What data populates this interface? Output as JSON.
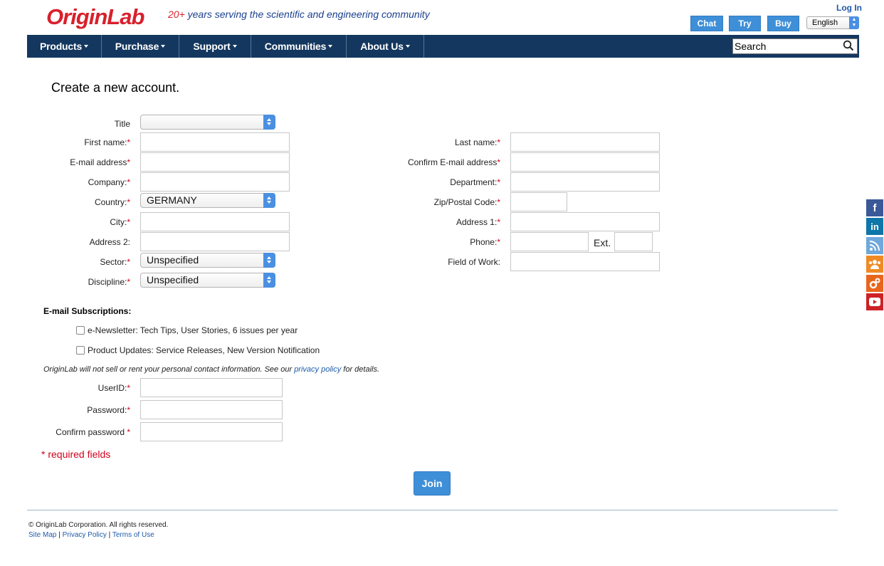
{
  "header": {
    "logo_text": "OriginLab",
    "tagline_num": "20+",
    "tagline_rest": " years serving the scientific and engineering community",
    "login": "Log In",
    "chat": "Chat",
    "try": "Try",
    "buy": "Buy",
    "language": "English"
  },
  "nav": {
    "items": [
      "Products",
      "Purchase",
      "Support",
      "Communities",
      "About Us"
    ],
    "search_placeholder": "Search"
  },
  "form": {
    "heading": "Create a new account.",
    "labels": {
      "title": "Title",
      "first_name": "First name:",
      "email": "E-mail address",
      "company": "Company:",
      "country": "Country:",
      "city": "City:",
      "address2": "Address 2:",
      "sector": "Sector:",
      "discipline": "Discipline:",
      "last_name": "Last name:",
      "confirm_email": "Confirm E-mail address",
      "department": "Department:",
      "zip": "Zip/Postal Code:",
      "address1": "Address 1:",
      "phone": "Phone:",
      "ext": "Ext.",
      "field_of_work": "Field of Work:",
      "userid": "UserID:",
      "password": "Password:",
      "confirm_password": "Confirm password "
    },
    "values": {
      "title": "",
      "country": "GERMANY",
      "sector": "Unspecified",
      "discipline": "Unspecified"
    },
    "required_mark": "*",
    "subscriptions_title": "E-mail Subscriptions:",
    "subscriptions": [
      "e-Newsletter: Tech Tips, User Stories, 6 issues per year",
      "Product Updates: Service Releases, New Version Notification"
    ],
    "privacy_pre": "OriginLab will not sell or rent your personal contact information. See our ",
    "privacy_link": "privacy policy",
    "privacy_post": " for details.",
    "required_note": "* required fields",
    "join": "Join"
  },
  "footer": {
    "copyright": "© OriginLab Corporation. All rights reserved.",
    "links": [
      "Site Map",
      "Privacy Policy",
      "Terms of Use"
    ],
    "separator": " | "
  },
  "social_icons": [
    "facebook-icon",
    "linkedin-icon",
    "blog-icon",
    "community-icon",
    "apps-icon",
    "youtube-icon"
  ],
  "colors": {
    "nav_bg": "#14375f",
    "button_blue": "#3f8fd8",
    "required_red": "#d0021b",
    "link_blue": "#1e5aa8"
  }
}
